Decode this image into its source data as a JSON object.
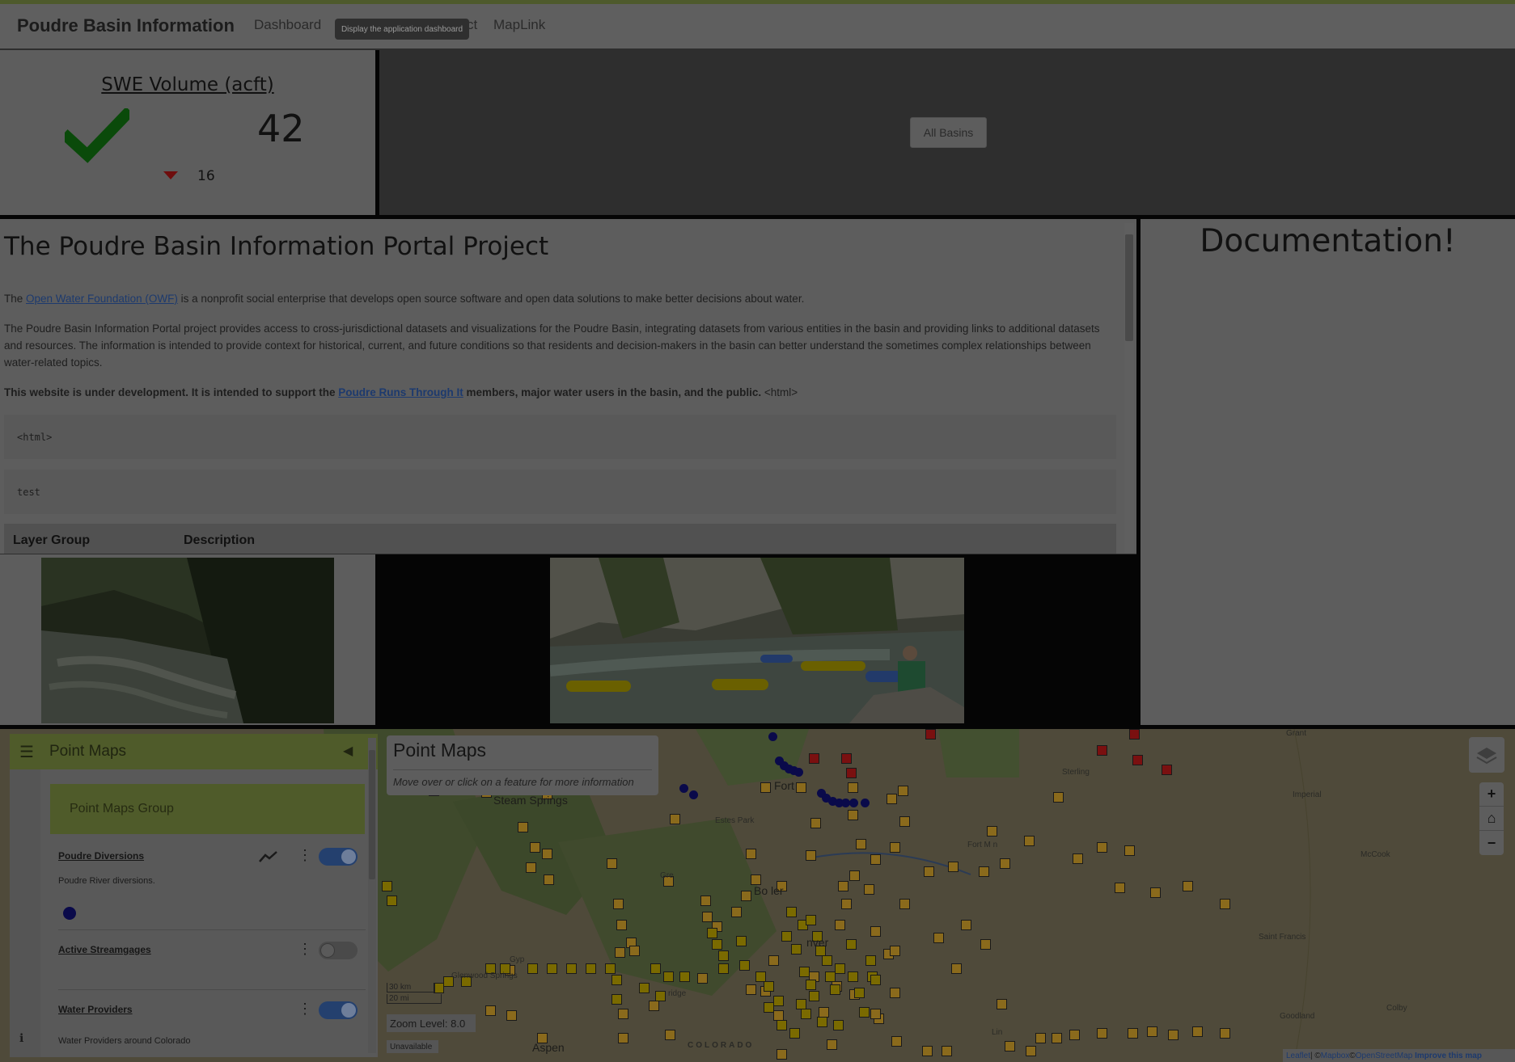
{
  "app": {
    "title": "Poudre Basin Information",
    "nav": [
      "Dashboard",
      "ct",
      "MapLink"
    ],
    "tooltip": "Display the application dashboard"
  },
  "swe": {
    "title": "SWE Volume (acft)",
    "value": "42",
    "change": "16",
    "status": "check-icon",
    "trend": "down"
  },
  "basins": {
    "button_label": "All Basins"
  },
  "content": {
    "heading": "The Poudre Basin Information Portal Project",
    "p1_pre": "The ",
    "p1_link": "Open Water Foundation (OWF)",
    "p1_post": " is a nonprofit social enterprise that develops open source software and open data solutions to make better decisions about water.",
    "p2": "The Poudre Basin Information Portal project provides access to cross-jurisdictional datasets and visualizations for the Poudre Basin, integrating datasets from various entities in the basin and providing links to additional datasets and resources. The information is intended to provide context for historical, current, and future conditions so that residents and decision-makers in the basin can better understand the sometimes complex relationships between water-related topics.",
    "p3_pre": "This website is under development. It is intended to support the ",
    "p3_link": "Poudre Runs Through It",
    "p3_post": " members, major water users in the basin, and the public.",
    "p3_tail": " <html>",
    "code1": "<html>",
    "code2": "test",
    "table_headers": [
      "Layer Group",
      "Description"
    ]
  },
  "documentation": {
    "title": "Documentation!"
  },
  "map": {
    "panel": {
      "title": "Point Maps",
      "group": "Point Maps Group",
      "layers": [
        {
          "name": "Poudre Diversions",
          "description": "Poudre River diversions.",
          "enabled": true
        },
        {
          "name": "Active Streamgages",
          "description": "",
          "enabled": false
        },
        {
          "name": "Water Providers",
          "description": "Water Providers around Colorado",
          "enabled": true
        }
      ]
    },
    "info": {
      "title": "Point Maps",
      "subtitle": "Move over or click on a feature for more information"
    },
    "zoom_controls": [
      "+",
      "⌂",
      "−"
    ],
    "scale": [
      "30 km",
      "20 mi"
    ],
    "zoom_level": "Zoom Level: 8.0",
    "unavailable": "Unavailable",
    "attribution": {
      "leaflet": "Leaflet",
      "sep1": " | © ",
      "mapbox": "Mapbox",
      "sep2": " © ",
      "osm": "OpenStreetMap",
      "improve": "Improve this map"
    },
    "labels": {
      "steamboat": "Steam   Springs",
      "fort": "Fort",
      "estes": "Estes Park",
      "boulder": "Bo  ler",
      "denver": "nver",
      "glenwood": "Glenwood Springs",
      "greeley": "Gre",
      "sterling": "Sterling",
      "imperial": "Imperial",
      "mccook": "McCook",
      "saint_francis": "Saint Francis",
      "goodland": "Goodland",
      "colby": "Colby",
      "grant": "Grant",
      "colorado": "COLORADO",
      "fort_morgan": "Fort M  n",
      "gyp": "Gyp",
      "aspen": "Aspen",
      "ridge": "ridge",
      "lincoln": "Lin"
    },
    "colors": {
      "diversion": "#0a0a4a",
      "provider": "#8a6a1c",
      "active": "#7a6a00",
      "red": "#7a1010"
    }
  }
}
